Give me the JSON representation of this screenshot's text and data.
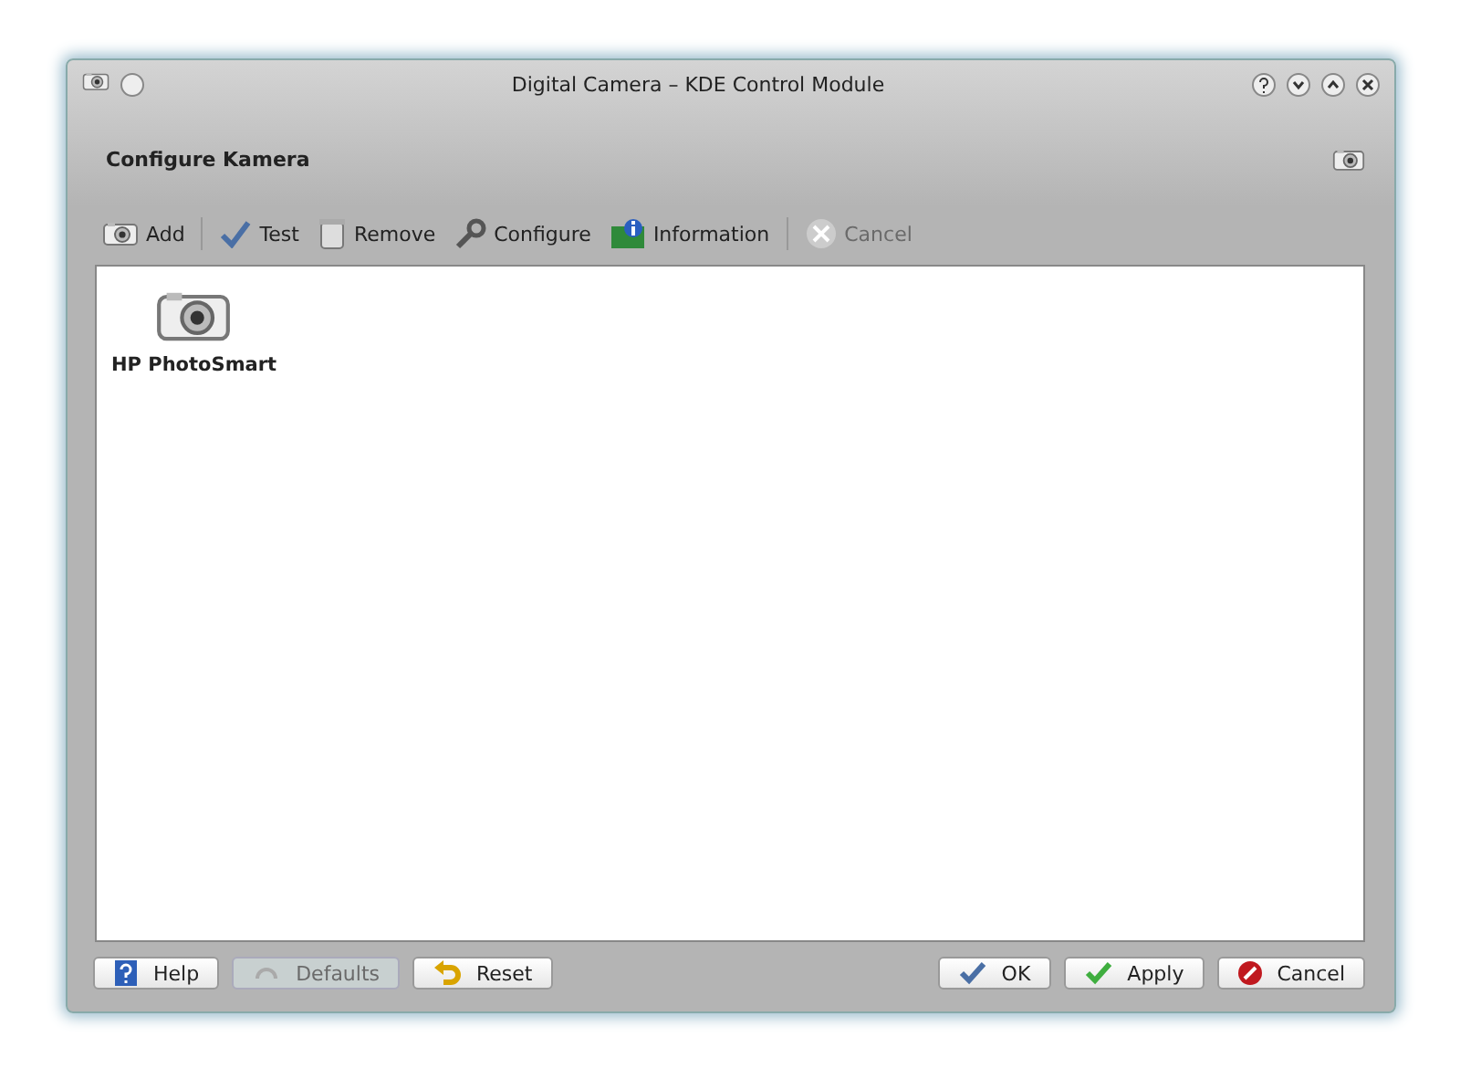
{
  "window": {
    "title": "Digital Camera – KDE Control Module"
  },
  "header": {
    "title": "Configure Kamera"
  },
  "toolbar": [
    {
      "kind": "action",
      "label": "Add",
      "disabled": false
    },
    {
      "kind": "separator"
    },
    {
      "kind": "action",
      "label": "Test",
      "disabled": false
    },
    {
      "kind": "action",
      "label": "Remove",
      "disabled": false
    },
    {
      "kind": "action",
      "label": "Configure",
      "disabled": false
    },
    {
      "kind": "action",
      "label": "Information",
      "disabled": false
    },
    {
      "kind": "separator"
    },
    {
      "kind": "action",
      "label": "Cancel",
      "disabled": true
    }
  ],
  "devices": [
    {
      "label": "HP PhotoSmart",
      "selected": false
    }
  ],
  "buttons_left": [
    {
      "label": "Help",
      "disabled": false
    },
    {
      "label": "Defaults",
      "disabled": true
    },
    {
      "label": "Reset",
      "disabled": false
    }
  ],
  "buttons_right": [
    {
      "label": "OK",
      "disabled": false
    },
    {
      "label": "Apply",
      "disabled": false
    },
    {
      "label": "Cancel",
      "disabled": false
    }
  ]
}
